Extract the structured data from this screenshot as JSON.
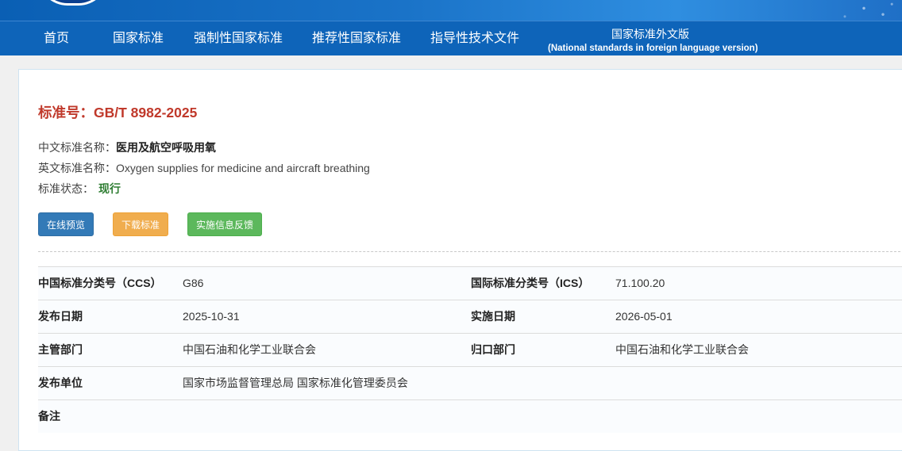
{
  "nav": {
    "items": [
      "首页",
      "国家标准",
      "强制性国家标准",
      "推荐性国家标准",
      "指导性技术文件"
    ],
    "foreign": {
      "title": "国家标准外文版",
      "subtitle": "(National standards in foreign language version)"
    }
  },
  "standard": {
    "number_label": "标准号：",
    "number": "GB/T 8982-2025",
    "cn_name_label": "中文标准名称：",
    "cn_name": "医用及航空呼吸用氧",
    "en_name_label": "英文标准名称：",
    "en_name": "Oxygen supplies for medicine and aircraft breathing",
    "status_label": "标准状态：",
    "status": "现行"
  },
  "buttons": {
    "preview": "在线预览",
    "download": "下载标准",
    "feedback": "实施信息反馈"
  },
  "details": [
    {
      "k1": "中国标准分类号（CCS）",
      "v1": "G86",
      "k2": "国际标准分类号（ICS）",
      "v2": "71.100.20"
    },
    {
      "k1": "发布日期",
      "v1": "2025-10-31",
      "k2": "实施日期",
      "v2": "2026-05-01"
    },
    {
      "k1": "主管部门",
      "v1": "中国石油和化学工业联合会",
      "k2": "归口部门",
      "v2": "中国石油和化学工业联合会"
    },
    {
      "k1": "发布单位",
      "v1": "国家市场监督管理总局 国家标准化管理委员会",
      "k2": "",
      "v2": ""
    },
    {
      "k1": "备注",
      "v1": "",
      "k2": "",
      "v2": ""
    }
  ],
  "colors": {
    "nav_bg": "#0e64b9",
    "title_red": "#c0392b",
    "status_green": "#2e7d32",
    "btn_blue": "#337ab7",
    "btn_orange": "#f0ad4e",
    "btn_green": "#5cb85c"
  }
}
